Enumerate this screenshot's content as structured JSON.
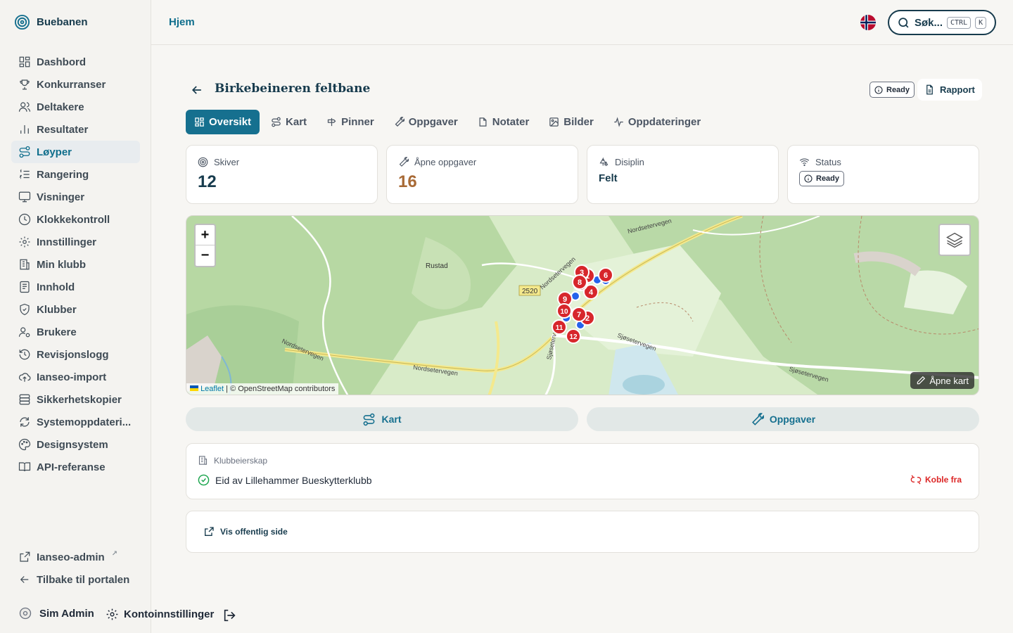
{
  "brand": {
    "name": "Buebanen"
  },
  "sidebar": {
    "items": [
      {
        "label": "Dashbord",
        "icon": "dashboard-icon"
      },
      {
        "label": "Konkurranser",
        "icon": "trophy-icon"
      },
      {
        "label": "Deltakere",
        "icon": "users-icon"
      },
      {
        "label": "Resultater",
        "icon": "bar-chart-icon"
      },
      {
        "label": "Løyper",
        "icon": "route-icon",
        "active": true
      },
      {
        "label": "Rangering",
        "icon": "ranking-list-icon"
      },
      {
        "label": "Visninger",
        "icon": "monitor-icon"
      },
      {
        "label": "Klokkekontroll",
        "icon": "clock-icon"
      },
      {
        "label": "Innstillinger",
        "icon": "gear-icon"
      },
      {
        "label": "Min klubb",
        "icon": "building-icon"
      },
      {
        "label": "Innhold",
        "icon": "document-icon"
      },
      {
        "label": "Klubber",
        "icon": "shield-icon"
      },
      {
        "label": "Brukere",
        "icon": "user-gear-icon"
      },
      {
        "label": "Revisjonslogg",
        "icon": "history-icon"
      },
      {
        "label": "Ianseo-import",
        "icon": "cloud-upload-icon"
      },
      {
        "label": "Sikkerhetskopier",
        "icon": "database-icon"
      },
      {
        "label": "Systemoppdateri...",
        "icon": "refresh-icon"
      },
      {
        "label": "Designsystem",
        "icon": "palette-icon"
      },
      {
        "label": "API-referanse",
        "icon": "book-icon"
      }
    ],
    "bottom": {
      "ianseo_admin": "Ianseo-admin",
      "ianseo_admin_mark": "↗",
      "back": "Tilbake til portalen"
    },
    "user": {
      "name": "Sim Admin",
      "settings": "Kontoinnstillinger"
    }
  },
  "topbar": {
    "breadcrumb": "Hjem",
    "search": {
      "placeholder": "Søk...",
      "key1": "CTRL",
      "key2": "K"
    }
  },
  "page": {
    "title": "Birkebeineren feltbane",
    "status_badge": "Ready",
    "report_button": "Rapport"
  },
  "tabs": [
    {
      "label": "Oversikt",
      "icon": "grid-icon",
      "active": true
    },
    {
      "label": "Kart",
      "icon": "route-icon"
    },
    {
      "label": "Pinner",
      "icon": "signpost-icon"
    },
    {
      "label": "Oppgaver",
      "icon": "wrench-icon"
    },
    {
      "label": "Notater",
      "icon": "note-icon"
    },
    {
      "label": "Bilder",
      "icon": "image-icon"
    },
    {
      "label": "Oppdateringer",
      "icon": "activity-icon"
    }
  ],
  "stats": {
    "targets": {
      "label": "Skiver",
      "value": "12"
    },
    "open_tasks": {
      "label": "Åpne oppgaver",
      "value": "16"
    },
    "discipline": {
      "label": "Disiplin",
      "value": "Felt"
    },
    "status": {
      "label": "Status",
      "value": "Ready"
    }
  },
  "map": {
    "zoom_in": "+",
    "zoom_out": "−",
    "attribution_leaflet": "Leaflet",
    "attribution_rest": " | © OpenStreetMap contributors",
    "open_map": "Åpne kart",
    "labels": {
      "rustad": "Rustad",
      "road_number": "2520",
      "nordsetervegen": "Nordsetervegen",
      "sjosetervegen": "Sjøsetervegen"
    },
    "target_markers": [
      "1",
      "2",
      "3",
      "4",
      "5",
      "6",
      "7",
      "8",
      "9",
      "10",
      "11",
      "12"
    ]
  },
  "actions": {
    "map": "Kart",
    "tasks": "Oppgaver"
  },
  "ownership": {
    "label": "Klubbeierskap",
    "club": "Eid av Lillehammer Bueskytterklubb",
    "unlink": "Koble fra"
  },
  "public_page": {
    "label": "Vis offentlig side"
  },
  "colors": {
    "primary": "#16708f",
    "navy": "#173b4d",
    "warning": "#a86a36",
    "danger": "#dc2626",
    "marker_red": "#d7262b",
    "marker_blue": "#2563eb"
  }
}
